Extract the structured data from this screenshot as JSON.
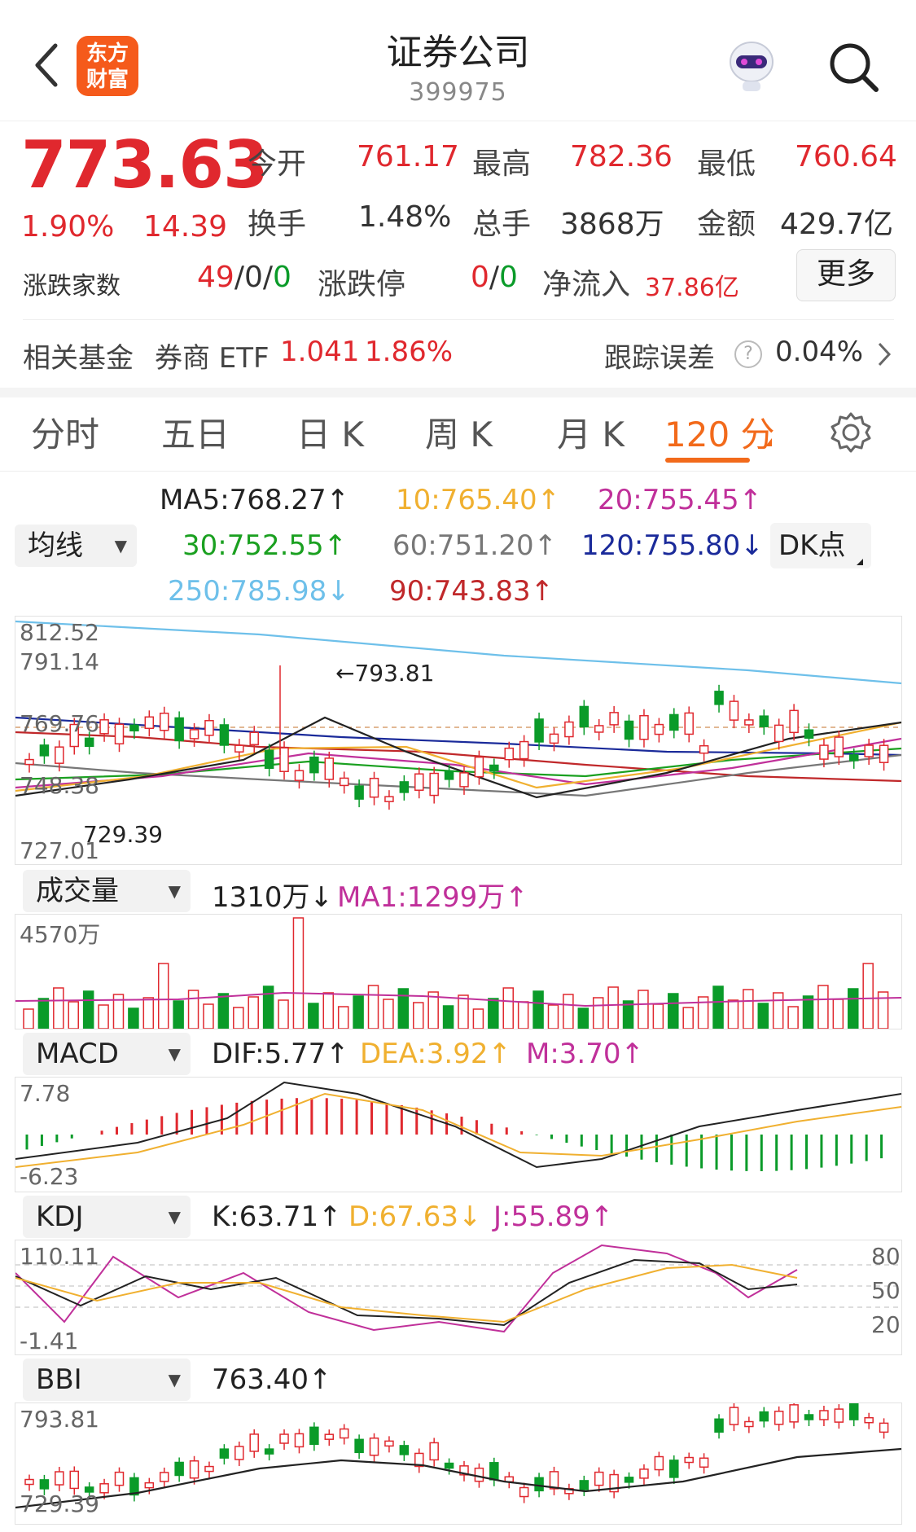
{
  "header": {
    "logo_line1": "东方",
    "logo_line2": "财富",
    "title": "证券公司",
    "code": "399975"
  },
  "quote": {
    "price": "773.63",
    "change_pct": "1.90%",
    "change": "14.39",
    "open_label": "今开",
    "open": "761.17",
    "high_label": "最高",
    "high": "782.36",
    "low_label": "最低",
    "low": "760.64",
    "turnover_label": "换手",
    "turnover": "1.48%",
    "volume_label": "总手",
    "volume": "3868万",
    "amount_label": "金额",
    "amount": "429.7亿",
    "breadth_label": "涨跌家数",
    "breadth_up": "49",
    "breadth_flat": "0",
    "breadth_down": "0",
    "limit_label": "涨跌停",
    "limit_up": "0",
    "limit_down": "0",
    "netflow_label": "净流入",
    "netflow": "37.86亿",
    "more_button": "更多"
  },
  "fund": {
    "label": "相关基金",
    "name": "券商 ETF",
    "price": "1.041",
    "pct": "1.86%",
    "tracking_label": "跟踪误差",
    "tracking_value": "0.04%"
  },
  "tabs": [
    "分时",
    "五日",
    "日 K",
    "周 K",
    "月 K",
    "120 分"
  ],
  "ma_panel": {
    "selector": "均线",
    "dk_button": "DK点",
    "ma5": "MA5:768.27↑",
    "ma10": "10:765.40↑",
    "ma20": "20:755.45↑",
    "ma30": "30:752.55↑",
    "ma60": "60:751.20↑",
    "ma120": "120:755.80↓",
    "ma250": "250:785.98↓",
    "ma90": "90:743.83↑",
    "y_labels": [
      "812.52",
      "791.14",
      "769.76",
      "748.38",
      "727.01"
    ],
    "high_marker": "←793.81",
    "low_marker": "729.39",
    "colors": {
      "ma5": "#222222",
      "ma10": "#f0b030",
      "ma20": "#c0309a",
      "ma30": "#1aa020",
      "ma60": "#777777",
      "ma120": "#1a2a9a",
      "ma250": "#6ec0ea",
      "ma90": "#c0282a"
    }
  },
  "volume_panel": {
    "selector": "成交量",
    "value": "1310万↓",
    "ma1": "MA1:1299万↑",
    "y_label": "4570万"
  },
  "macd_panel": {
    "selector": "MACD",
    "dif": "DIF:5.77↑",
    "dea": "DEA:3.92↑",
    "m": "M:3.70↑",
    "y_top": "7.78",
    "y_bottom": "-6.23"
  },
  "kdj_panel": {
    "selector": "KDJ",
    "k": "K:63.71↑",
    "d": "D:67.63↓",
    "j": "J:55.89↑",
    "y_top": "110.11",
    "y_bottom": "-1.41",
    "right_labels": [
      "80",
      "50",
      "20"
    ]
  },
  "bbi_panel": {
    "selector": "BBI",
    "value": "763.40↑",
    "y_top": "793.81",
    "y_bottom": "729.39"
  }
}
